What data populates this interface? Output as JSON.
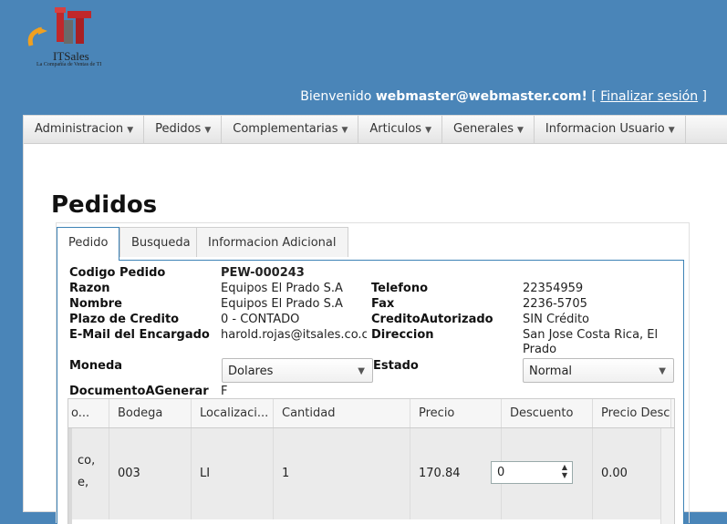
{
  "logo": {
    "brand": "ITSales",
    "tagline": "La Compañía de Ventas de TI"
  },
  "header": {
    "welcome_prefix": "Bienvenido",
    "user": "webmaster@webmaster.com!",
    "bracket_open": "[",
    "logout": "Finalizar sesión",
    "bracket_close": "]"
  },
  "menu": [
    {
      "label": "Administracion"
    },
    {
      "label": "Pedidos"
    },
    {
      "label": "Complementarias"
    },
    {
      "label": "Articulos"
    },
    {
      "label": "Generales"
    },
    {
      "label": "Informacion Usuario"
    }
  ],
  "page": {
    "title": "Pedidos"
  },
  "tabs": [
    {
      "label": "Pedido",
      "active": true
    },
    {
      "label": "Busqueda",
      "active": false
    },
    {
      "label": "Informacion Adicional",
      "active": false
    }
  ],
  "form": {
    "codigo_label": "Codigo Pedido",
    "codigo_value": "PEW-000243",
    "razon_label": "Razon",
    "razon_value": "Equipos El Prado S.A",
    "nombre_label": "Nombre",
    "nombre_value": "Equipos El Prado S.A",
    "plazo_label": "Plazo de Credito",
    "plazo_value": "0 - CONTADO",
    "email_label": "E-Mail del Encargado",
    "email_value": "harold.rojas@itsales.co.cr",
    "telefono_label": "Telefono",
    "telefono_value": "22354959",
    "fax_label": "Fax",
    "fax_value": "2236-5705",
    "credito_label": "CreditoAutorizado",
    "credito_value": "SIN Crédito",
    "direccion_label": "Direccion",
    "direccion_value_1": "San Jose Costa Rica, El",
    "direccion_value_2": "Prado",
    "moneda_label": "Moneda",
    "moneda_value": "Dolares",
    "estado_label": "Estado",
    "estado_value": "Normal",
    "documento_label": "DocumentoAGenerar",
    "documento_value": "F"
  },
  "grid": {
    "headers": [
      "o...",
      "Bodega",
      "Localizaci...",
      "Cantidad",
      "Precio",
      "Descuento",
      "Precio Desc..."
    ],
    "row": {
      "desc_line1": "co,",
      "desc_line2": "e,",
      "bodega": "003",
      "localizacion": "LI",
      "cantidad": "1",
      "precio": "170.84",
      "descuento": "0",
      "precio_desc": "0.00"
    }
  }
}
